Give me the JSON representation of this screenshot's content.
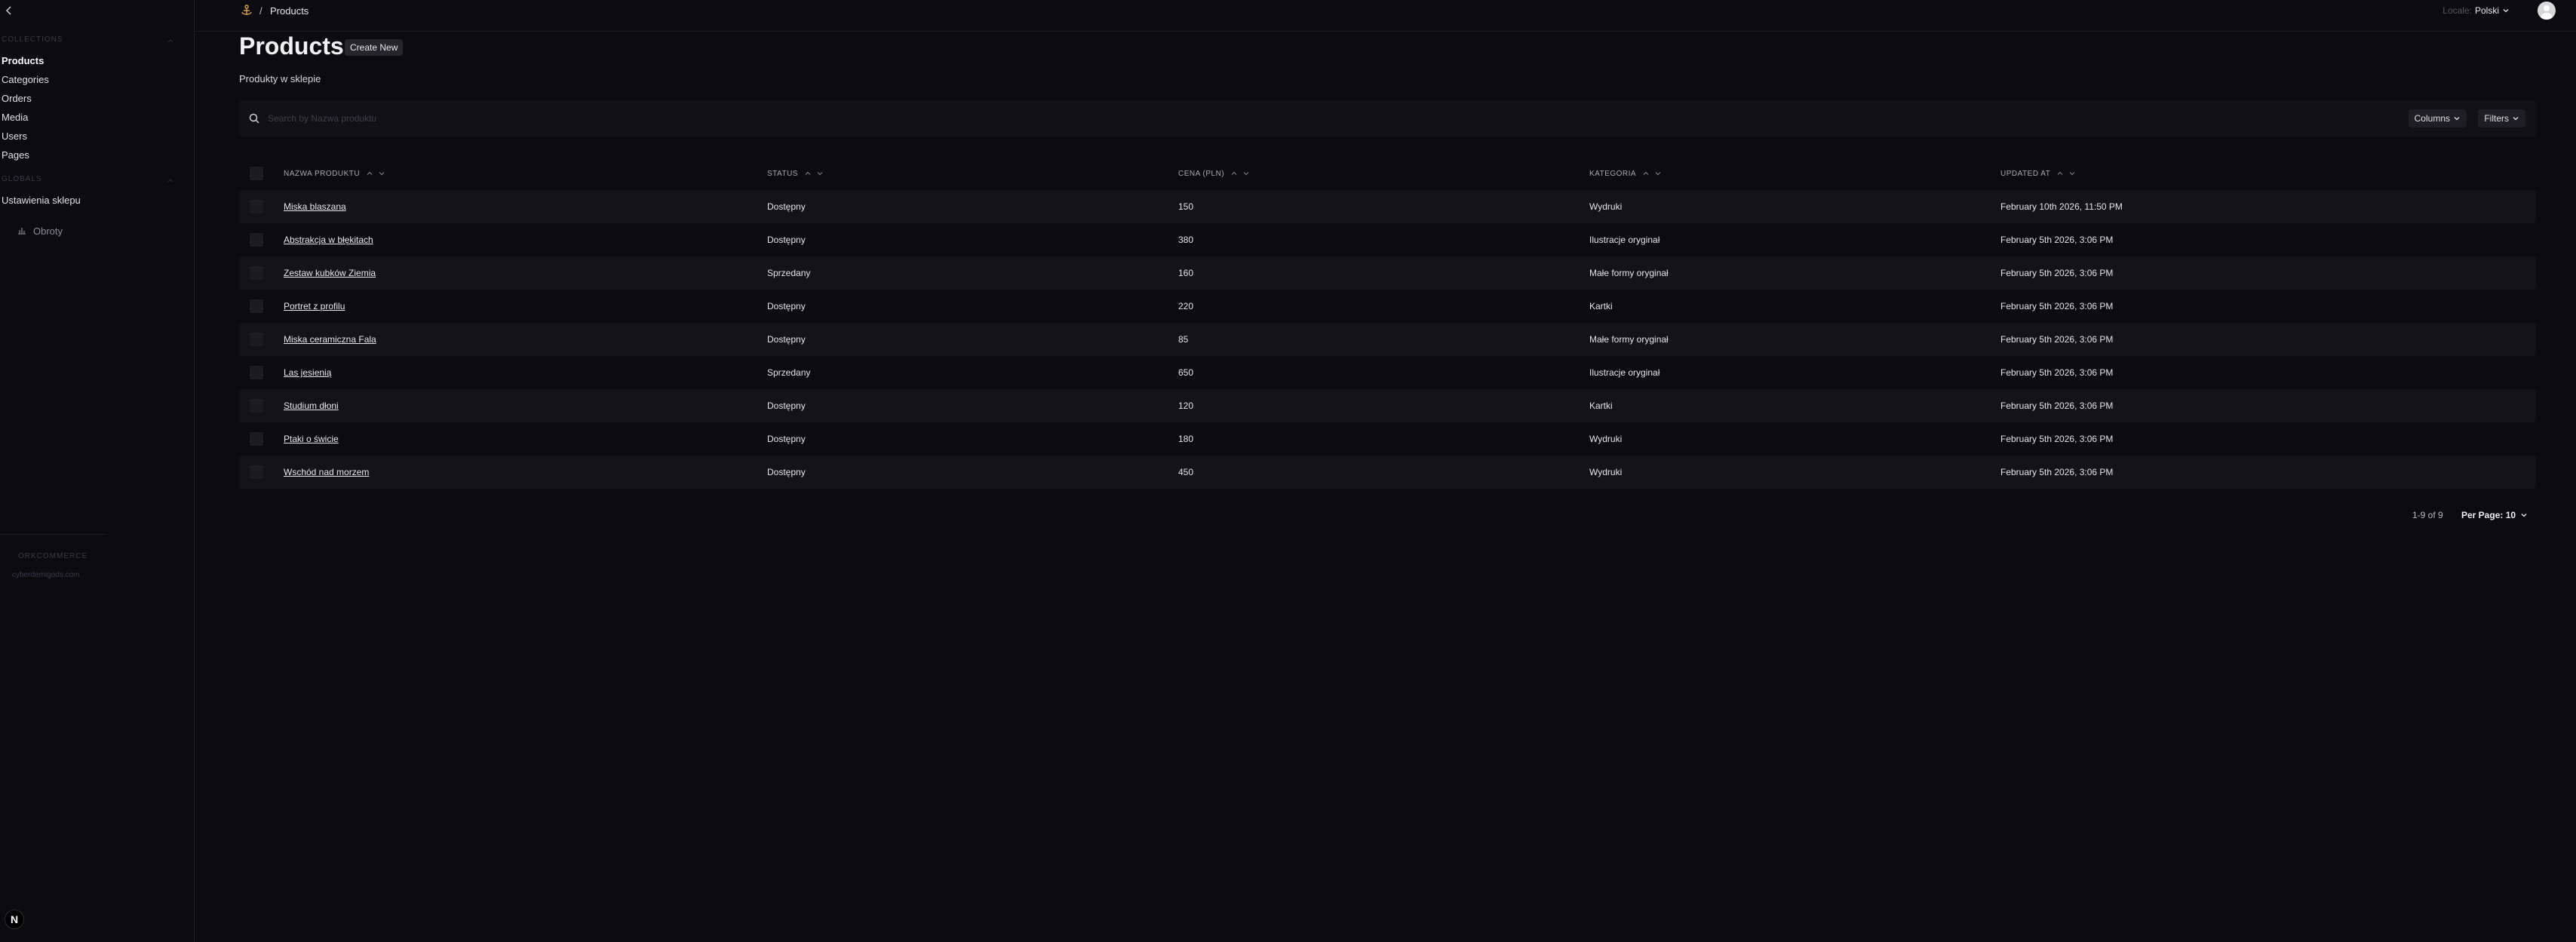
{
  "sidebar": {
    "group_collections": "COLLECTIONS",
    "items": [
      {
        "label": "Products",
        "active": true
      },
      {
        "label": "Categories"
      },
      {
        "label": "Orders"
      },
      {
        "label": "Media"
      },
      {
        "label": "Users"
      },
      {
        "label": "Pages"
      }
    ],
    "group_globals": "GLOBALS",
    "globals": [
      {
        "label": "Ustawienia sklepu"
      }
    ],
    "sub_link": {
      "label": "Obroty",
      "icon": "bar-chart-icon"
    },
    "brand_name": "ORKCOMMERCE",
    "brand_email": "cyberdemigods.com"
  },
  "header": {
    "breadcrumb_sep": "/",
    "breadcrumb_page": "Products",
    "locale_label": "Locale:",
    "locale_value": "Polski"
  },
  "main": {
    "title": "Products",
    "create_label": "Create New",
    "subtitle": "Produkty w sklepie",
    "search_placeholder": "Search by Nazwa produktu",
    "columns_label": "Columns",
    "filters_label": "Filters"
  },
  "table": {
    "headers": [
      "NAZWA PRODUKTU",
      "STATUS",
      "CENA (PLN)",
      "KATEGORIA",
      "UPDATED AT"
    ],
    "rows": [
      {
        "name": "Miska blaszana",
        "status": "Dostępny",
        "price": "150",
        "category": "Wydruki",
        "updated": "February 10th 2026, 11:50 PM"
      },
      {
        "name": "Abstrakcja w błękitach",
        "status": "Dostępny",
        "price": "380",
        "category": "Ilustracje oryginał",
        "updated": "February 5th 2026, 3:06 PM"
      },
      {
        "name": "Zestaw kubków Ziemia",
        "status": "Sprzedany",
        "price": "160",
        "category": "Małe formy oryginał",
        "updated": "February 5th 2026, 3:06 PM"
      },
      {
        "name": "Portret z profilu",
        "status": "Dostępny",
        "price": "220",
        "category": "Kartki",
        "updated": "February 5th 2026, 3:06 PM"
      },
      {
        "name": "Miska ceramiczna Fala",
        "status": "Dostępny",
        "price": "85",
        "category": "Małe formy oryginał",
        "updated": "February 5th 2026, 3:06 PM"
      },
      {
        "name": "Las jesienią",
        "status": "Sprzedany",
        "price": "650",
        "category": "Ilustracje oryginał",
        "updated": "February 5th 2026, 3:06 PM"
      },
      {
        "name": "Studium dłoni",
        "status": "Dostępny",
        "price": "120",
        "category": "Kartki",
        "updated": "February 5th 2026, 3:06 PM"
      },
      {
        "name": "Ptaki o świcie",
        "status": "Dostępny",
        "price": "180",
        "category": "Wydruki",
        "updated": "February 5th 2026, 3:06 PM"
      },
      {
        "name": "Wschód nad morzem",
        "status": "Dostępny",
        "price": "450",
        "category": "Wydruki",
        "updated": "February 5th 2026, 3:06 PM"
      }
    ]
  },
  "pagination": {
    "count": "1-9 of 9",
    "per_page_label": "Per Page: 10"
  },
  "colors": {
    "background": "#0c0c10",
    "accent_logo": "#e2a33a",
    "row_stripe": "#131318"
  }
}
